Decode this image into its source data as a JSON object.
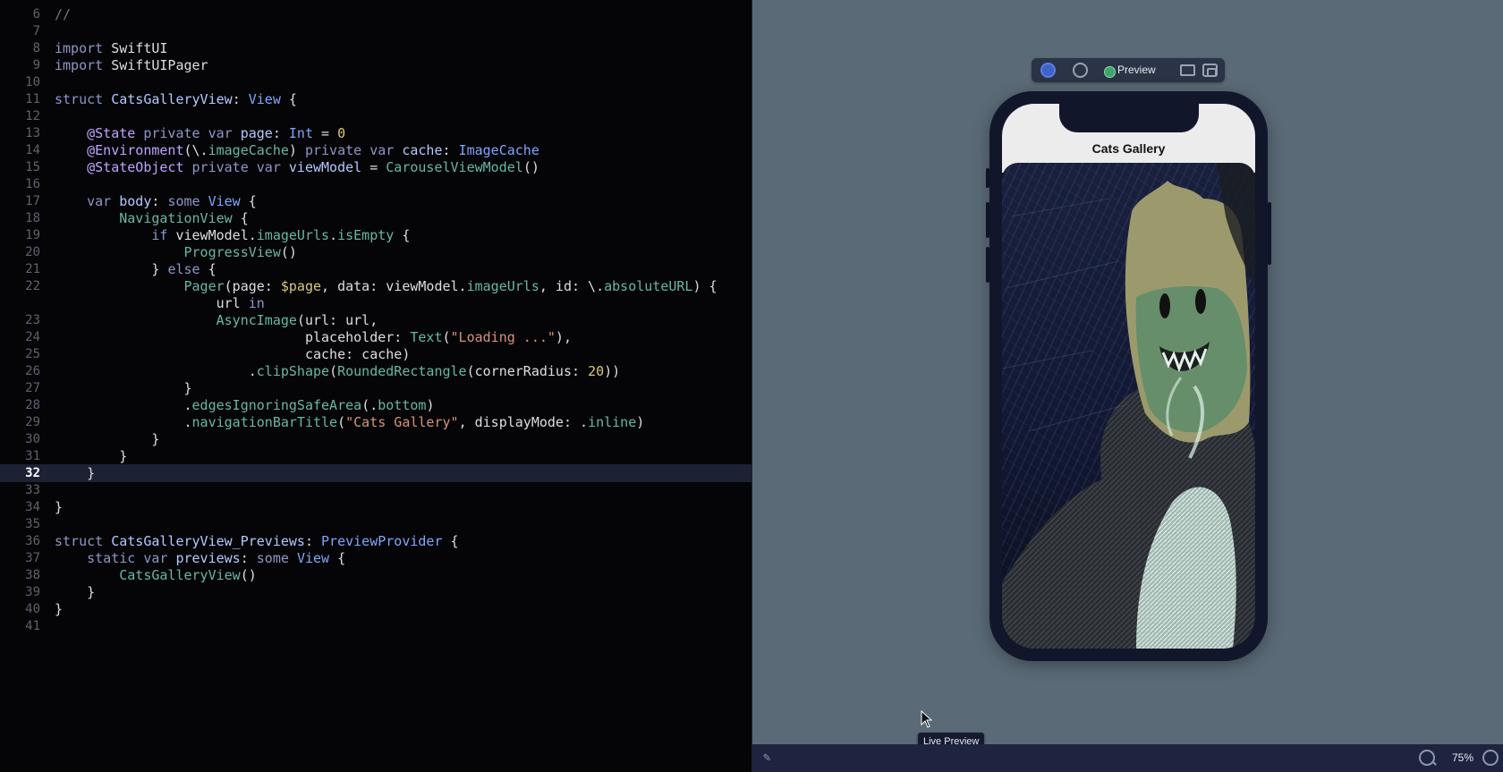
{
  "editor": {
    "current_line": "32",
    "lines": [
      {
        "num": "6",
        "text": "//"
      },
      {
        "num": "7",
        "text": ""
      },
      {
        "num": "8",
        "text": "import SwiftUI"
      },
      {
        "num": "9",
        "text": "import SwiftUIPager"
      },
      {
        "num": "10",
        "text": ""
      },
      {
        "num": "11",
        "text": "struct CatsGalleryView: View {"
      },
      {
        "num": "12",
        "text": ""
      },
      {
        "num": "13",
        "text": "    @State private var page: Int = 0"
      },
      {
        "num": "14",
        "text": "    @Environment(\\.imageCache) private var cache: ImageCache"
      },
      {
        "num": "15",
        "text": "    @StateObject private var viewModel = CarouselViewModel()"
      },
      {
        "num": "16",
        "text": ""
      },
      {
        "num": "17",
        "text": "    var body: some View {"
      },
      {
        "num": "18",
        "text": "        NavigationView {"
      },
      {
        "num": "19",
        "text": "            if viewModel.imageUrls.isEmpty {"
      },
      {
        "num": "20",
        "text": "                ProgressView()"
      },
      {
        "num": "21",
        "text": "            } else {"
      },
      {
        "num": "22",
        "text": "                Pager(page: $page, data: viewModel.imageUrls, id: \\.absoluteURL) {"
      },
      {
        "num": "",
        "text": "                    url in"
      },
      {
        "num": "23",
        "text": "                    AsyncImage(url: url,"
      },
      {
        "num": "24",
        "text": "                               placeholder: Text(\"Loading ...\"),"
      },
      {
        "num": "25",
        "text": "                               cache: cache)"
      },
      {
        "num": "26",
        "text": "                        .clipShape(RoundedRectangle(cornerRadius: 20))"
      },
      {
        "num": "27",
        "text": "                }"
      },
      {
        "num": "28",
        "text": "                .edgesIgnoringSafeArea(.bottom)"
      },
      {
        "num": "29",
        "text": "                .navigationBarTitle(\"Cats Gallery\", displayMode: .inline)"
      },
      {
        "num": "30",
        "text": "            }"
      },
      {
        "num": "31",
        "text": "        }"
      },
      {
        "num": "32",
        "text": "    }"
      },
      {
        "num": "33",
        "text": ""
      },
      {
        "num": "34",
        "text": "}"
      },
      {
        "num": "35",
        "text": ""
      },
      {
        "num": "36",
        "text": "struct CatsGalleryView_Previews: PreviewProvider {"
      },
      {
        "num": "37",
        "text": "    static var previews: some View {"
      },
      {
        "num": "38",
        "text": "        CatsGalleryView()"
      },
      {
        "num": "39",
        "text": "    }"
      },
      {
        "num": "40",
        "text": "}"
      },
      {
        "num": "41",
        "text": ""
      }
    ]
  },
  "preview": {
    "toolbar": {
      "preview_label": "Preview"
    },
    "nav_title": "Cats Gallery",
    "tooltip": "Live Preview",
    "zoom": "75%"
  },
  "icons": {
    "live_preview": "play-circle-icon",
    "device_settings": "device-settings-icon",
    "preview_status": "status-dot-icon",
    "device": "display-icon",
    "duplicate": "duplicate-icon",
    "pin": "pin-icon",
    "zoom_out": "zoom-out-icon",
    "zoom_in": "zoom-in-icon",
    "cursor": "cursor-icon"
  },
  "colors": {
    "editor_bg": "#050507",
    "canvas_bg": "#5a6b77",
    "keyword": "#8e96c8",
    "type": "#7fa6ff",
    "string": "#d8947a",
    "number": "#d9c97c",
    "function": "#67b7a4"
  }
}
